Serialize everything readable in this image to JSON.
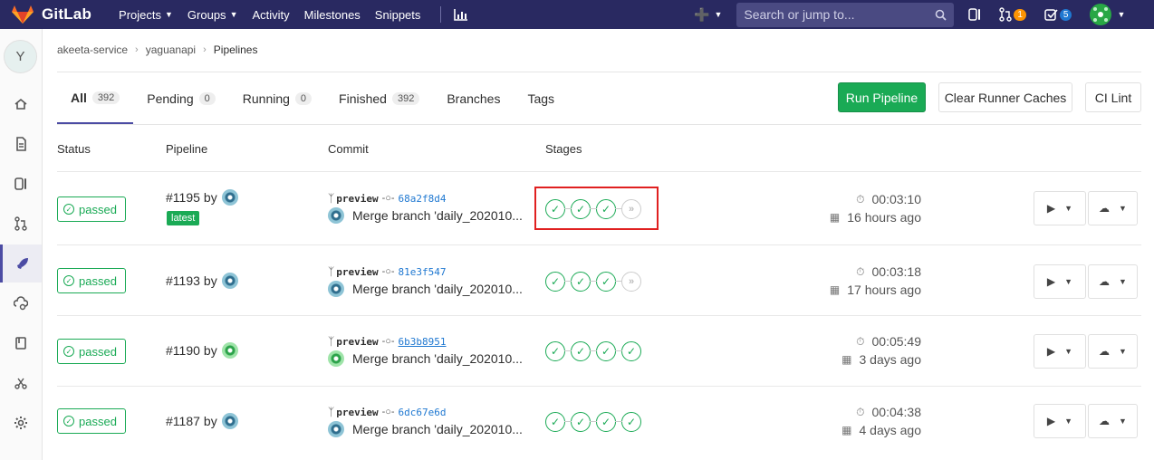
{
  "navbar": {
    "brand": "GitLab",
    "links": [
      {
        "label": "Projects",
        "dropdown": true
      },
      {
        "label": "Groups",
        "dropdown": true
      },
      {
        "label": "Activity",
        "dropdown": false
      },
      {
        "label": "Milestones",
        "dropdown": false
      },
      {
        "label": "Snippets",
        "dropdown": false
      }
    ],
    "search_placeholder": "Search or jump to...",
    "merge_requests_count": "1",
    "todos_count": "5"
  },
  "sidebar": {
    "project_initial": "Y",
    "items": [
      "home-icon",
      "repository-icon",
      "issues-icon",
      "merge-requests-icon",
      "ci-cd-icon",
      "operations-icon",
      "wiki-icon",
      "snippets-icon",
      "settings-icon"
    ],
    "active": "ci-cd-icon"
  },
  "breadcrumb": [
    "akeeta-service",
    "yaguanapi",
    "Pipelines"
  ],
  "tabs": [
    {
      "label": "All",
      "count": "392"
    },
    {
      "label": "Pending",
      "count": "0"
    },
    {
      "label": "Running",
      "count": "0"
    },
    {
      "label": "Finished",
      "count": "392"
    },
    {
      "label": "Branches",
      "count": null
    },
    {
      "label": "Tags",
      "count": null
    }
  ],
  "buttons": {
    "run_pipeline": "Run Pipeline",
    "clear_caches": "Clear Runner Caches",
    "ci_lint": "CI Lint"
  },
  "table_headers": {
    "status": "Status",
    "pipeline": "Pipeline",
    "commit": "Commit",
    "stages": "Stages"
  },
  "pipelines": [
    {
      "status": "passed",
      "id": "#1195",
      "by": "by",
      "latest": "latest",
      "avatar": "blue",
      "ref": "preview",
      "sha": "68a2f8d4",
      "sha_underlined": false,
      "message": "Merge branch 'daily_202010...",
      "stages": [
        "success",
        "success",
        "success",
        "skipped"
      ],
      "duration": "00:03:10",
      "finished": "16 hours ago"
    },
    {
      "status": "passed",
      "id": "#1193",
      "by": "by",
      "latest": null,
      "avatar": "blue",
      "ref": "preview",
      "sha": "81e3f547",
      "sha_underlined": false,
      "message": "Merge branch 'daily_202010...",
      "stages": [
        "success",
        "success",
        "success",
        "skipped"
      ],
      "duration": "00:03:18",
      "finished": "17 hours ago"
    },
    {
      "status": "passed",
      "id": "#1190",
      "by": "by",
      "latest": null,
      "avatar": "green",
      "ref": "preview",
      "sha": "6b3b8951",
      "sha_underlined": true,
      "message": "Merge branch 'daily_202010...",
      "stages": [
        "success",
        "success",
        "success",
        "success"
      ],
      "duration": "00:05:49",
      "finished": "3 days ago"
    },
    {
      "status": "passed",
      "id": "#1187",
      "by": "by",
      "latest": null,
      "avatar": "blue",
      "ref": "preview",
      "sha": "6dc67e6d",
      "sha_underlined": false,
      "message": "Merge branch 'daily_202010...",
      "stages": [
        "success",
        "success",
        "success",
        "success"
      ],
      "duration": "00:04:38",
      "finished": "4 days ago"
    }
  ],
  "colors": {
    "navbar": "#292961",
    "success": "#1aaa55",
    "link": "#1f78d1",
    "highlight": "#e02020"
  }
}
